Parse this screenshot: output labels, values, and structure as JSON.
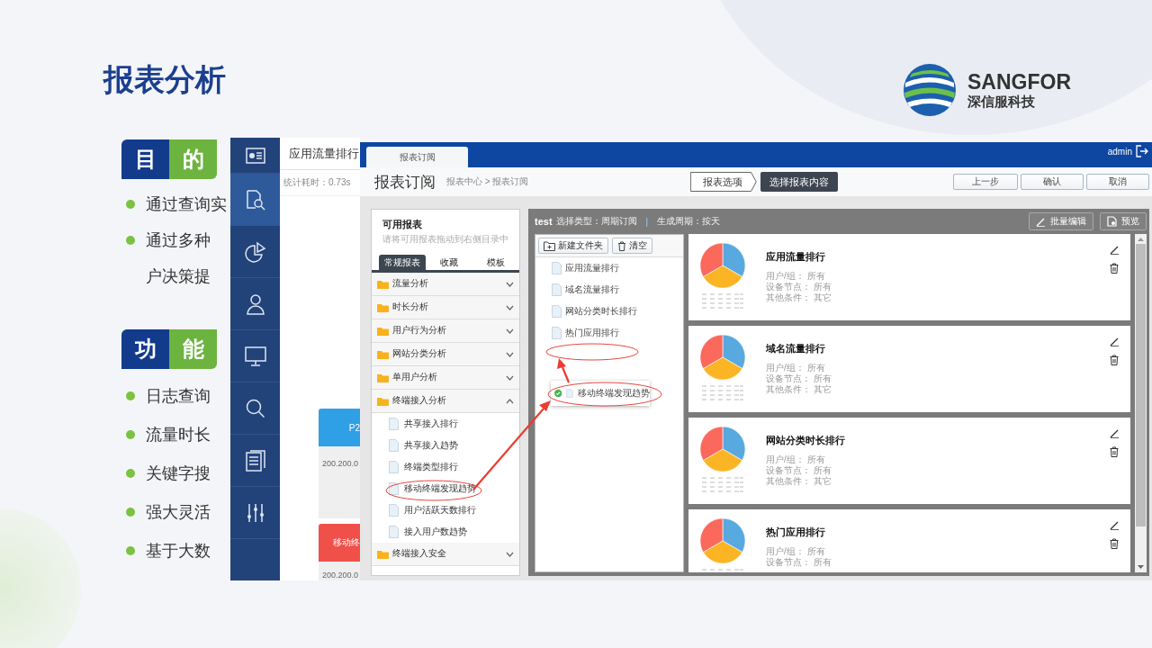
{
  "slide": {
    "title": "报表分析",
    "logo": {
      "name": "SANGFOR",
      "subtitle": "深信服科技"
    }
  },
  "sections": [
    {
      "badge": [
        "目",
        "的"
      ],
      "bullets": [
        {
          "lines": [
            "通过查询实"
          ]
        },
        {
          "lines": [
            "通过多种",
            "户决策提"
          ]
        }
      ]
    },
    {
      "badge": [
        "功",
        "能"
      ],
      "bullets": [
        {
          "lines": [
            "日志查询"
          ]
        },
        {
          "lines": [
            "流量时长"
          ]
        },
        {
          "lines": [
            "关键字搜"
          ]
        },
        {
          "lines": [
            "强大灵活"
          ]
        },
        {
          "lines": [
            "基于大数"
          ]
        }
      ]
    }
  ],
  "back_window": {
    "nav_items": [
      {
        "kind": "id-card",
        "selected": false
      },
      {
        "kind": "report-search",
        "selected": true
      },
      {
        "kind": "pie",
        "selected": false
      },
      {
        "kind": "user",
        "selected": false
      },
      {
        "kind": "monitor",
        "selected": false
      },
      {
        "kind": "search",
        "selected": false
      },
      {
        "kind": "documents",
        "selected": false
      },
      {
        "kind": "sliders",
        "selected": false
      }
    ],
    "title": "应用流量排行",
    "stats": "统计耗时：0.73s",
    "cards": [
      {
        "header": "P2",
        "color": "#2f9fe6",
        "ip": "200.200.0"
      },
      {
        "header": "移动终",
        "color": "#f0504a",
        "ip": "200.200.0"
      }
    ]
  },
  "front_window": {
    "tab": "报表订阅",
    "user": "admin",
    "page_title": "报表订阅",
    "breadcrumb": "报表中心 > 报表订阅",
    "steps": [
      {
        "label": "报表选项",
        "selected": false
      },
      {
        "label": "选择报表内容",
        "selected": true
      }
    ],
    "buttons": [
      "上一步",
      "确认",
      "取消"
    ],
    "available": {
      "title": "可用报表",
      "hint": "请将可用报表拖动到右侧目录中",
      "tabs": [
        {
          "label": "常规报表",
          "selected": true
        },
        {
          "label": "收藏",
          "selected": false
        },
        {
          "label": "模板",
          "selected": false
        }
      ],
      "groups": [
        {
          "label": "流量分析",
          "expanded": false
        },
        {
          "label": "时长分析",
          "expanded": false
        },
        {
          "label": "用户行为分析",
          "expanded": false
        },
        {
          "label": "网站分类分析",
          "expanded": false
        },
        {
          "label": "单用户分析",
          "expanded": false
        },
        {
          "label": "终端接入分析",
          "expanded": true,
          "children": [
            "共享接入排行",
            "共享接入趋势",
            "终端类型排行",
            "移动终端发现趋势",
            "用户活跃天数排行",
            "接入用户数趋势"
          ]
        },
        {
          "label": "终端接入安全",
          "expanded": false
        }
      ]
    },
    "subscription": {
      "name": "test",
      "type_label": "选择类型：周期订阅",
      "separator": "|",
      "period_label": "生成周期：按天",
      "actions": [
        "批量编辑",
        "预览"
      ],
      "toolbar": [
        "新建文件夹",
        "清空"
      ],
      "items": [
        "应用流量排行",
        "域名流量排行",
        "网站分类时长排行",
        "热门应用排行"
      ],
      "dragging": "移动终端发现趋势",
      "cards": [
        {
          "title": "应用流量排行",
          "conditions": [
            "用户/组： 所有",
            "设备节点： 所有",
            "其他条件： 其它"
          ]
        },
        {
          "title": "域名流量排行",
          "conditions": [
            "用户/组： 所有",
            "设备节点： 所有",
            "其他条件： 其它"
          ]
        },
        {
          "title": "网站分类时长排行",
          "conditions": [
            "用户/组： 所有",
            "设备节点： 所有",
            "其他条件： 其它"
          ]
        },
        {
          "title": "热门应用排行",
          "conditions": [
            "用户/组： 所有",
            "设备节点： 所有"
          ]
        }
      ]
    }
  }
}
